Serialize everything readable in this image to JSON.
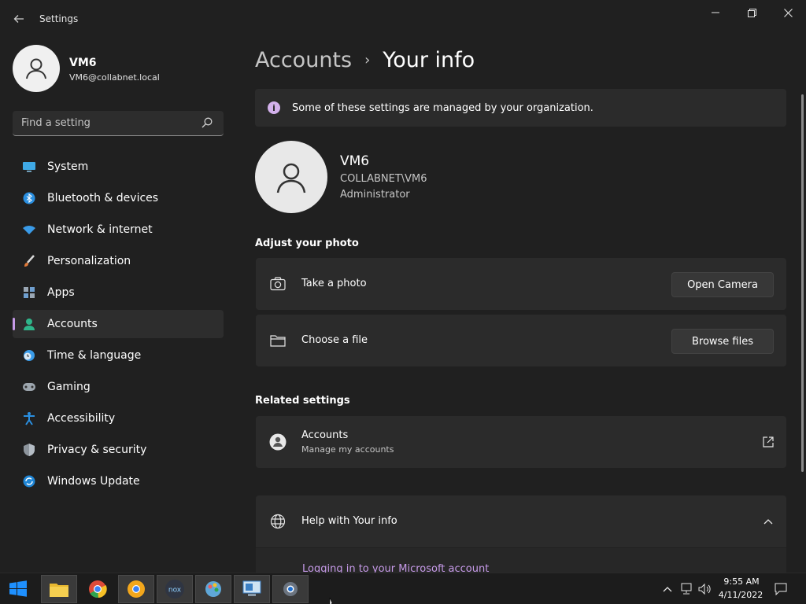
{
  "window": {
    "title": "Settings",
    "back_icon": "back-arrow-icon",
    "controls": [
      "minimize-icon",
      "restore-icon",
      "close-icon"
    ]
  },
  "profile": {
    "name": "VM6",
    "email": "VM6@collabnet.local"
  },
  "search": {
    "placeholder": "Find a setting"
  },
  "sidebar": {
    "items": [
      {
        "label": "System",
        "icon": "system-icon"
      },
      {
        "label": "Bluetooth & devices",
        "icon": "bluetooth-icon"
      },
      {
        "label": "Network & internet",
        "icon": "wifi-icon"
      },
      {
        "label": "Personalization",
        "icon": "brush-icon"
      },
      {
        "label": "Apps",
        "icon": "apps-icon"
      },
      {
        "label": "Accounts",
        "icon": "accounts-icon",
        "selected": true
      },
      {
        "label": "Time & language",
        "icon": "clock-globe-icon"
      },
      {
        "label": "Gaming",
        "icon": "gamepad-icon"
      },
      {
        "label": "Accessibility",
        "icon": "accessibility-icon"
      },
      {
        "label": "Privacy & security",
        "icon": "shield-icon"
      },
      {
        "label": "Windows Update",
        "icon": "update-icon"
      }
    ]
  },
  "main": {
    "breadcrumb": {
      "parent": "Accounts",
      "separator": "›",
      "current": "Your info"
    },
    "info_bar": {
      "text": "Some of these settings are managed by your organization."
    },
    "user": {
      "name": "VM6",
      "domain": "COLLABNET\\VM6",
      "role": "Administrator"
    },
    "adjust_photo": {
      "title": "Adjust your photo",
      "take_photo": {
        "label": "Take a photo",
        "button": "Open Camera"
      },
      "choose_file": {
        "label": "Choose a file",
        "button": "Browse files"
      }
    },
    "related": {
      "title": "Related settings",
      "accounts": {
        "label": "Accounts",
        "sublabel": "Manage my accounts"
      }
    },
    "help": {
      "title": "Help with Your info",
      "link": "Logging in to your Microsoft account"
    }
  },
  "taskbar": {
    "apps": [
      "start-icon",
      "file-explorer-icon",
      "chrome-icon",
      "chrome-canary-icon",
      "nox-icon",
      "paint-icon",
      "remote-desktop-icon",
      "settings-icon"
    ],
    "time": "9:55 AM",
    "date": "4/11/2022"
  },
  "colors": {
    "accent": "#c69ae8",
    "background": "#202020",
    "card": "#2b2b2b"
  }
}
